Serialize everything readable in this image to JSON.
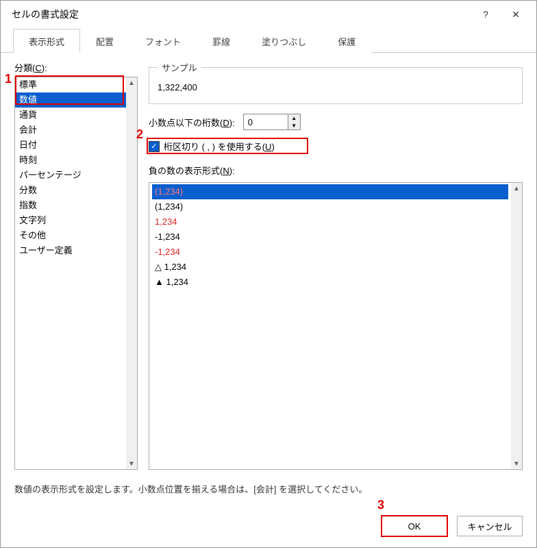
{
  "window": {
    "title": "セルの書式設定"
  },
  "titlebar": {
    "help": "?",
    "close": "✕"
  },
  "tabs": {
    "display": "表示形式",
    "align": "配置",
    "font": "フォント",
    "border": "罫線",
    "fill": "塗りつぶし",
    "protect": "保護"
  },
  "category": {
    "label_prefix": "分類(",
    "label_mnemonic": "C",
    "label_suffix": "):",
    "items": [
      "標準",
      "数値",
      "通貨",
      "会計",
      "日付",
      "時刻",
      "パーセンテージ",
      "分数",
      "指数",
      "文字列",
      "その他",
      "ユーザー定義"
    ],
    "selected_index": 1
  },
  "sample": {
    "legend": "サンプル",
    "value": "1,322,400"
  },
  "decimal": {
    "label_prefix": "小数点以下の桁数(",
    "label_mnemonic": "D",
    "label_suffix": "):",
    "value": "0"
  },
  "thousands": {
    "label_prefix": "桁区切り ( , ) を使用する(",
    "label_mnemonic": "U",
    "label_suffix": ")",
    "checked": true
  },
  "negative": {
    "label_prefix": "負の数の表示形式(",
    "label_mnemonic": "N",
    "label_suffix": "):",
    "items": [
      {
        "text": "(1,234)",
        "color": "red",
        "selected": true
      },
      {
        "text": "(1,234)",
        "color": "black"
      },
      {
        "text": "1,234",
        "color": "red"
      },
      {
        "text": "-1,234",
        "color": "black"
      },
      {
        "text": "-1,234",
        "color": "red"
      },
      {
        "text": "△ 1,234",
        "color": "black"
      },
      {
        "text": "▲ 1,234",
        "color": "black"
      }
    ]
  },
  "description": "数値の表示形式を設定します。小数点位置を揃える場合は、[会計] を選択してください。",
  "buttons": {
    "ok": "OK",
    "cancel": "キャンセル"
  },
  "annotations": {
    "n1": "1",
    "n2": "2",
    "n3": "3"
  }
}
